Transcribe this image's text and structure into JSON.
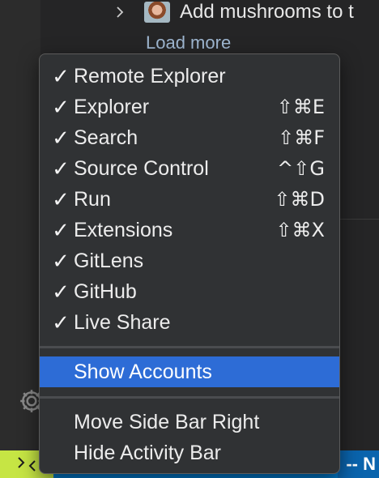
{
  "tree": {
    "commit_label": "Add mushrooms to t",
    "load_more": "Load more"
  },
  "menu": {
    "items": [
      {
        "label": "Remote Explorer",
        "checked": "✓",
        "shortcut": ""
      },
      {
        "label": "Explorer",
        "checked": "✓",
        "shortcut": "⇧⌘E"
      },
      {
        "label": "Search",
        "checked": "✓",
        "shortcut": "⇧⌘F"
      },
      {
        "label": "Source Control",
        "checked": "✓",
        "shortcut": "^⇧G"
      },
      {
        "label": "Run",
        "checked": "✓",
        "shortcut": "⇧⌘D"
      },
      {
        "label": "Extensions",
        "checked": "✓",
        "shortcut": "⇧⌘X"
      },
      {
        "label": "GitLens",
        "checked": "✓",
        "shortcut": ""
      },
      {
        "label": "GitHub",
        "checked": "✓",
        "shortcut": ""
      },
      {
        "label": "Live Share",
        "checked": "✓",
        "shortcut": ""
      }
    ],
    "show_accounts": "Show Accounts",
    "move_side_bar": "Move Side Bar Right",
    "hide_activity_bar": "Hide Activity Bar"
  },
  "status_bar": {
    "mode_text": "-- N",
    "remote_icon": "remote-icon"
  },
  "colors": {
    "menu_highlight": "#2d6cd6",
    "status_bar": "#007acc",
    "remote_indicator": "#c6e544"
  }
}
